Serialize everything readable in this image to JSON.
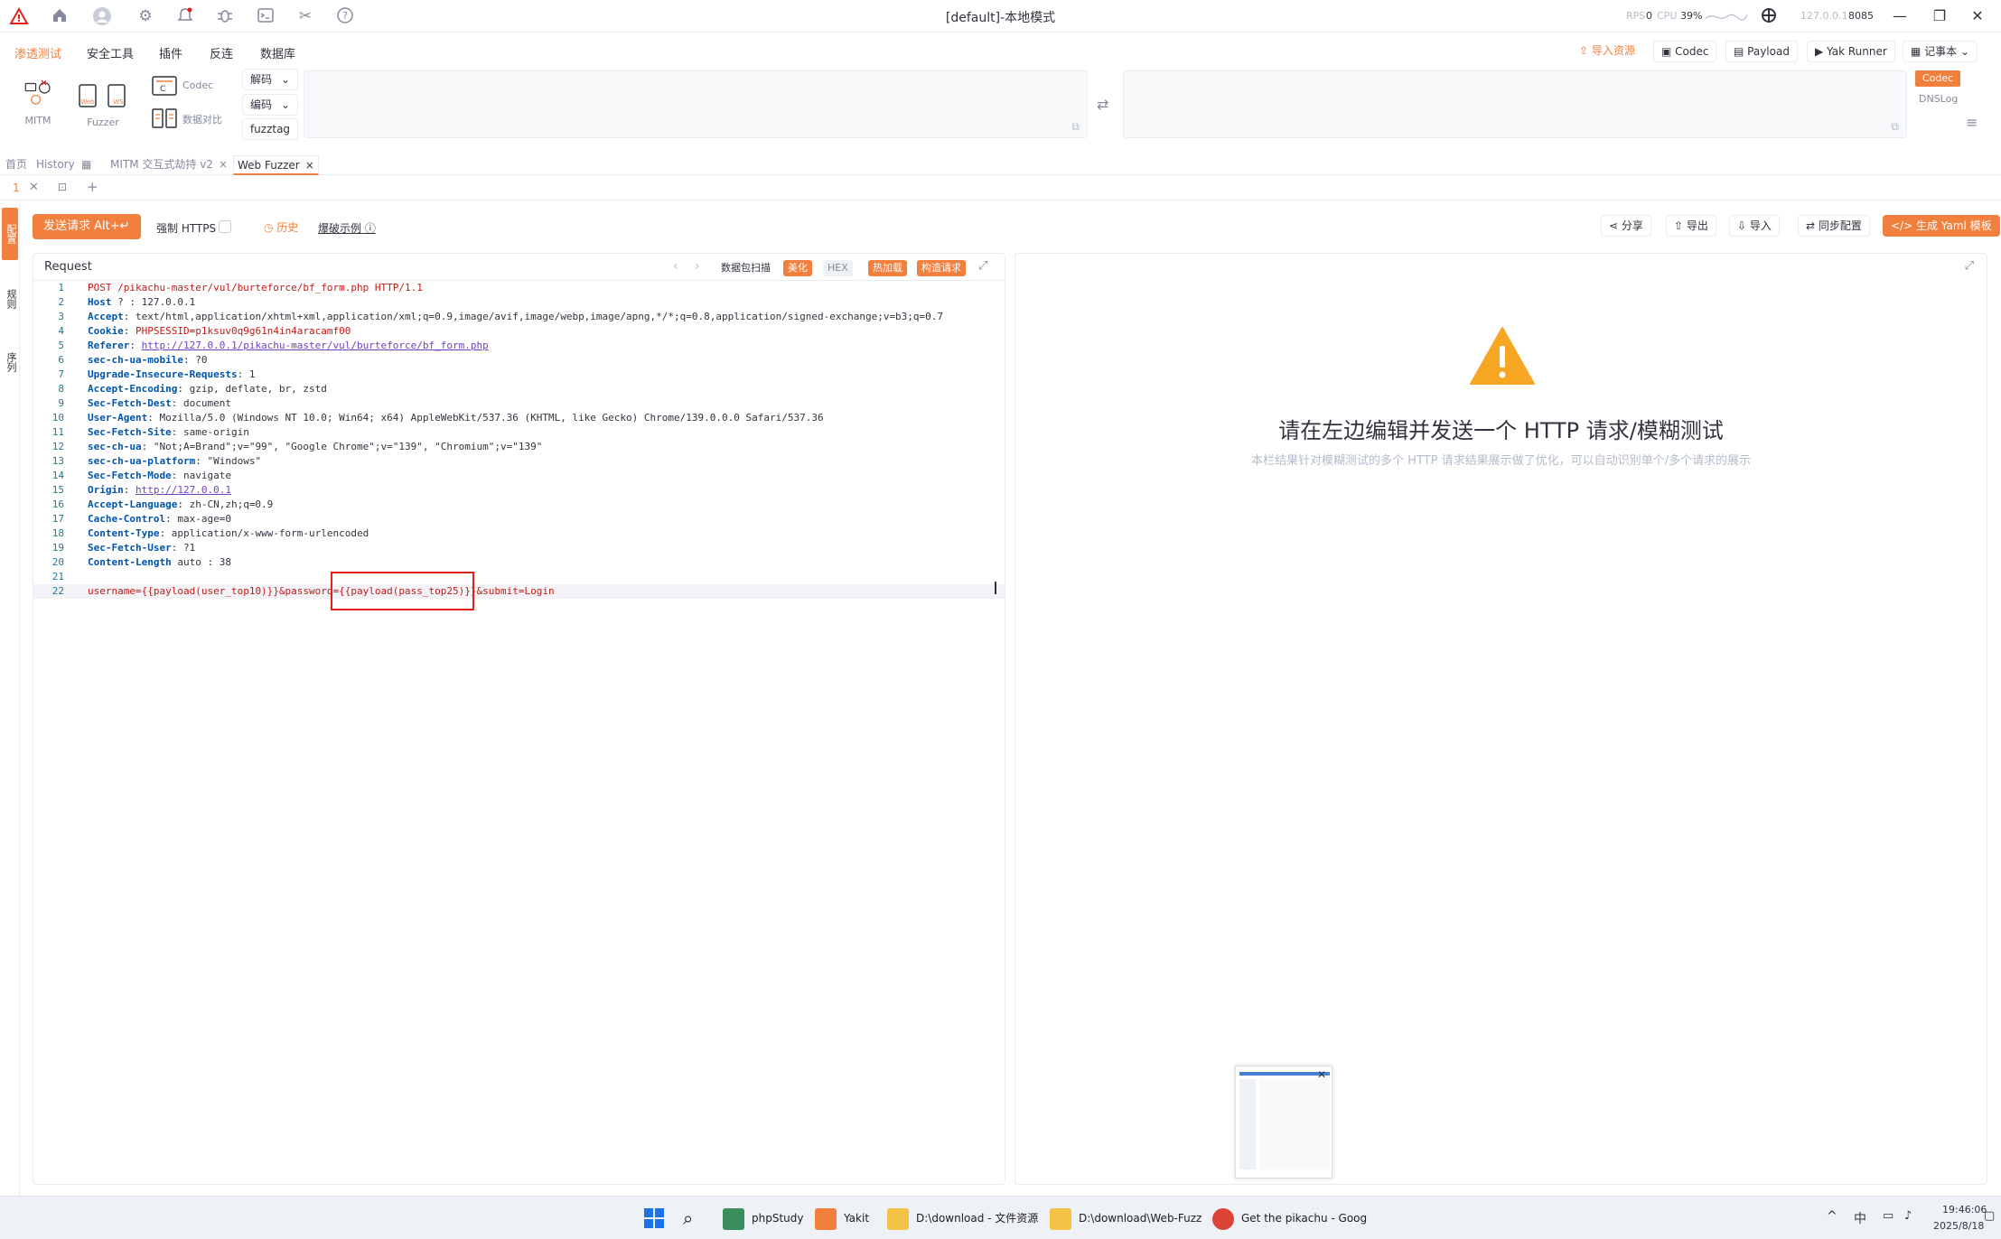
{
  "app": {
    "title": "[default]-本地模式",
    "rps_label": "RPS",
    "rps_value": "0",
    "cpu_label": "CPU",
    "cpu_value": "39%",
    "ip": "127.0.0.1",
    "port": "8085"
  },
  "menubar": {
    "items": [
      "渗透测试",
      "安全工具",
      "插件",
      "反连",
      "数据库"
    ],
    "active_index": 0,
    "right_buttons": {
      "import": "导入资源",
      "codec": "Codec",
      "payload": "Payload",
      "yak_runner": "Yak Runner",
      "notebook": "记事本"
    }
  },
  "toolbar": {
    "mitm": "MITM",
    "fuzzer": "Fuzzer",
    "codec": "Codec",
    "compare": "数据对比",
    "decode": "解码",
    "encode": "编码",
    "fuzztag": "fuzztag",
    "codec_tag": "Codec",
    "dnslog_tag": "DNSLog"
  },
  "tabs": {
    "items": [
      "首页",
      "History",
      "MITM 交互式劫持 v2",
      "Web Fuzzer"
    ],
    "active_index": 3,
    "sub_tab_index": "1"
  },
  "sidebar": {
    "items": [
      "配置",
      "规则",
      "序列"
    ]
  },
  "actions": {
    "send": "发送请求 Alt+↵",
    "force_https": "强制 HTTPS",
    "history": "历史",
    "examples": "爆破示例",
    "share": "分享",
    "export": "导出",
    "import": "导入",
    "sync_config": "同步配置",
    "gen_yaml": "生成 Yaml 模板"
  },
  "request": {
    "title": "Request",
    "tags": {
      "scan": "数据包扫描",
      "beautify": "美化",
      "hex": "HEX",
      "hot_reload": "热加载",
      "build": "构造请求"
    },
    "lines": [
      {
        "n": "1",
        "segments": [
          {
            "t": "POST /pikachu-master/vul/burteforce/bf_form.php HTTP/1.1",
            "c": "k"
          }
        ]
      },
      {
        "n": "2",
        "segments": [
          {
            "t": "Host",
            "c": "h"
          },
          {
            "t": " ? ",
            "c": "v"
          },
          {
            "t": ": 127.0.0.1",
            "c": "v"
          }
        ]
      },
      {
        "n": "3",
        "segments": [
          {
            "t": "Accept",
            "c": "h"
          },
          {
            "t": ": text/html,application/xhtml+xml,application/xml;q=0.9,image/avif,image/webp,image/apng,*/*;q=0.8,application/signed-exchange;v=b3;q=0.7",
            "c": "v"
          }
        ]
      },
      {
        "n": "4",
        "segments": [
          {
            "t": "Cookie",
            "c": "h"
          },
          {
            "t": ": ",
            "c": "v"
          },
          {
            "t": "PHPSESSID=p1ksuv0q9g61n4in4aracamf00",
            "c": "p"
          }
        ]
      },
      {
        "n": "5",
        "segments": [
          {
            "t": "Referer",
            "c": "h"
          },
          {
            "t": ": ",
            "c": "v"
          },
          {
            "t": "http://127.0.0.1/pikachu-master/vul/burteforce/bf_form.php",
            "c": "u"
          }
        ]
      },
      {
        "n": "6",
        "segments": [
          {
            "t": "sec-ch-ua-mobile",
            "c": "h"
          },
          {
            "t": ": ?0",
            "c": "v"
          }
        ]
      },
      {
        "n": "7",
        "segments": [
          {
            "t": "Upgrade-Insecure-Requests",
            "c": "h"
          },
          {
            "t": ": 1",
            "c": "v"
          }
        ]
      },
      {
        "n": "8",
        "segments": [
          {
            "t": "Accept-Encoding",
            "c": "h"
          },
          {
            "t": ": gzip, deflate, br, zstd",
            "c": "v"
          }
        ]
      },
      {
        "n": "9",
        "segments": [
          {
            "t": "Sec-Fetch-Dest",
            "c": "h"
          },
          {
            "t": ": document",
            "c": "v"
          }
        ]
      },
      {
        "n": "10",
        "segments": [
          {
            "t": "User-Agent",
            "c": "h"
          },
          {
            "t": ": Mozilla/5.0 (Windows NT 10.0; Win64; x64) AppleWebKit/537.36 (KHTML, like Gecko) Chrome/139.0.0.0 Safari/537.36",
            "c": "v"
          }
        ]
      },
      {
        "n": "11",
        "segments": [
          {
            "t": "Sec-Fetch-Site",
            "c": "h"
          },
          {
            "t": ": same-origin",
            "c": "v"
          }
        ]
      },
      {
        "n": "12",
        "segments": [
          {
            "t": "sec-ch-ua",
            "c": "h"
          },
          {
            "t": ": \"Not;A=Brand\";v=\"99\", \"Google Chrome\";v=\"139\", \"Chromium\";v=\"139\"",
            "c": "v"
          }
        ]
      },
      {
        "n": "13",
        "segments": [
          {
            "t": "sec-ch-ua-platform",
            "c": "h"
          },
          {
            "t": ": \"Windows\"",
            "c": "v"
          }
        ]
      },
      {
        "n": "14",
        "segments": [
          {
            "t": "Sec-Fetch-Mode",
            "c": "h"
          },
          {
            "t": ": navigate",
            "c": "v"
          }
        ]
      },
      {
        "n": "15",
        "segments": [
          {
            "t": "Origin",
            "c": "h"
          },
          {
            "t": ": ",
            "c": "v"
          },
          {
            "t": "http://127.0.0.1",
            "c": "u"
          }
        ]
      },
      {
        "n": "16",
        "segments": [
          {
            "t": "Accept-Language",
            "c": "h"
          },
          {
            "t": ": zh-CN,zh;q=0.9",
            "c": "v"
          }
        ]
      },
      {
        "n": "17",
        "segments": [
          {
            "t": "Cache-Control",
            "c": "h"
          },
          {
            "t": ": max-age=0",
            "c": "v"
          }
        ]
      },
      {
        "n": "18",
        "segments": [
          {
            "t": "Content-Type",
            "c": "h"
          },
          {
            "t": ": application/x-www-form-urlencoded",
            "c": "v"
          }
        ]
      },
      {
        "n": "19",
        "segments": [
          {
            "t": "Sec-Fetch-User",
            "c": "h"
          },
          {
            "t": ": ?1",
            "c": "v"
          }
        ]
      },
      {
        "n": "20",
        "segments": [
          {
            "t": "Content-Length",
            "c": "h"
          },
          {
            "t": " auto ",
            "c": "v"
          },
          {
            "t": ": 38",
            "c": "v"
          }
        ]
      },
      {
        "n": "21",
        "segments": []
      },
      {
        "n": "22",
        "segments": [
          {
            "t": "username=",
            "c": "p"
          },
          {
            "t": "{{payload(user_top10)}}",
            "c": "k"
          },
          {
            "t": "&password=",
            "c": "p"
          },
          {
            "t": "{{payload(pass_top25)}}",
            "c": "k"
          },
          {
            "t": "&submit=Login",
            "c": "p"
          }
        ]
      }
    ]
  },
  "response": {
    "title": "请在左边编辑并发送一个 HTTP 请求/模糊测试",
    "subtitle": "本栏结果针对模糊测试的多个 HTTP 请求结果展示做了优化，可以自动识别单个/多个请求的展示"
  },
  "taskbar": {
    "apps": [
      "phpStudy",
      "Yakit",
      "D:\\download - 文件资源",
      "D:\\download\\Web-Fuzz",
      "Get the pikachu - Goog"
    ],
    "time": "19:46:06",
    "date": "2025/8/18",
    "ime": "中"
  },
  "colors": {
    "accent": "#f17f3e",
    "warning": "#f6a623",
    "highlight_box": "#e0221b"
  }
}
